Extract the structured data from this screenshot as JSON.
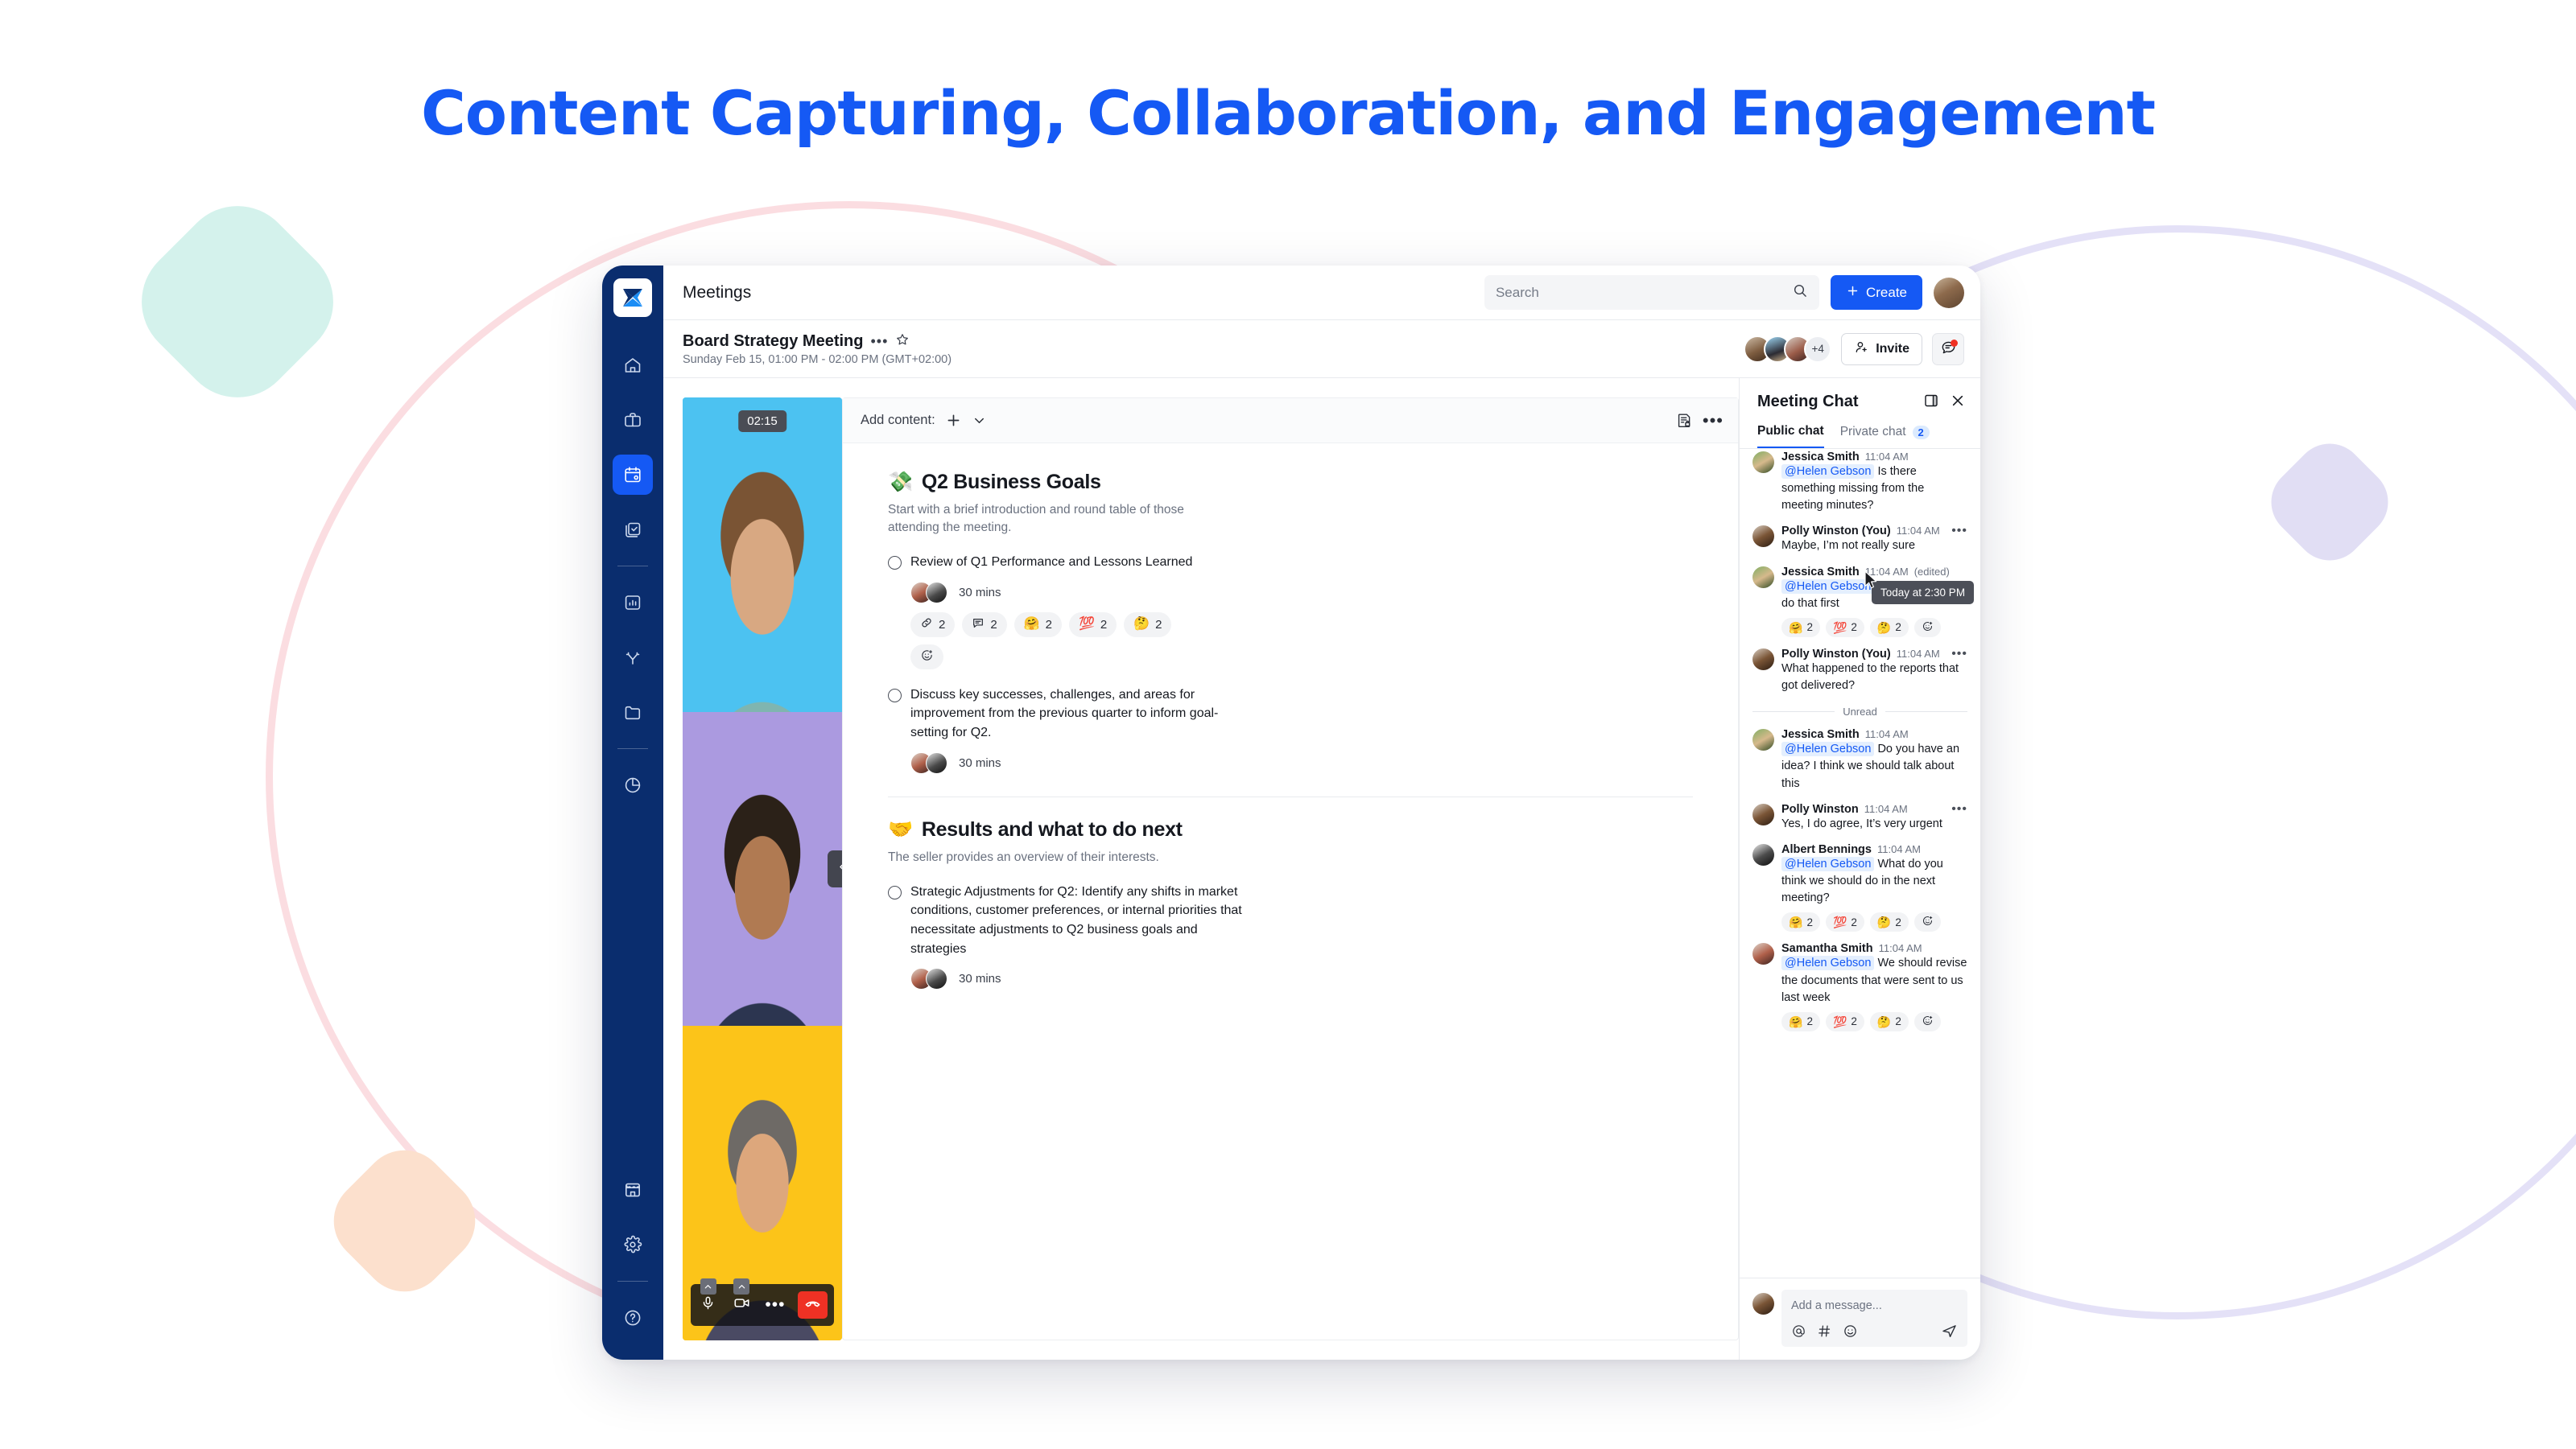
{
  "headline": "Content Capturing, Collaboration, and Engagement",
  "colors": {
    "brand_blue": "#1559f4",
    "rail_navy": "#0a2d6e",
    "danger_red": "#ef3124",
    "mention_blue": "#1559f4",
    "deco_teal": "#d4f2ec",
    "deco_purple": "#e1def4",
    "deco_orange": "#fce0cd"
  },
  "rail": {
    "logo_name": "app-logo",
    "items": [
      {
        "name": "home",
        "icon": "home-icon",
        "active": false
      },
      {
        "name": "briefcase",
        "icon": "briefcase-icon",
        "active": false
      },
      {
        "name": "meetings",
        "icon": "calendar-icon",
        "active": true
      },
      {
        "name": "tasks",
        "icon": "checklist-icon",
        "active": false
      },
      {
        "name": "reports",
        "icon": "bar-chart-icon",
        "active": false
      },
      {
        "name": "workflows",
        "icon": "branch-icon",
        "active": false
      },
      {
        "name": "files",
        "icon": "folder-icon",
        "active": false
      },
      {
        "name": "analytics",
        "icon": "pie-chart-icon",
        "active": false
      }
    ],
    "bottom_items": [
      {
        "name": "marketplace",
        "icon": "store-icon"
      },
      {
        "name": "settings",
        "icon": "gear-icon"
      },
      {
        "name": "help",
        "icon": "question-circle-icon"
      }
    ]
  },
  "topbar": {
    "title": "Meetings",
    "search_placeholder": "Search",
    "search_value": "",
    "create_label": "Create"
  },
  "meeting": {
    "title": "Board Strategy Meeting",
    "datetime": "Sunday Feb 15, 01:00 PM - 02:00 PM (GMT+02:00)",
    "overflow_count": "+4",
    "invite_label": "Invite"
  },
  "video": {
    "timer": "02:15",
    "tiles": [
      {
        "name": "participant-tile-1",
        "bg": "#4cc2f1"
      },
      {
        "name": "participant-tile-2",
        "bg": "#ab9ae0"
      },
      {
        "name": "participant-tile-3",
        "bg": "#fcc419"
      }
    ],
    "controls": [
      {
        "name": "microphone-button",
        "icon": "microphone-icon",
        "has_caret": true
      },
      {
        "name": "camera-button",
        "icon": "video-camera-icon",
        "has_caret": true
      },
      {
        "name": "more-options-button",
        "icon": "ellipsis-icon",
        "has_caret": false
      },
      {
        "name": "hang-up-button",
        "icon": "phone-hangup-icon",
        "has_caret": false
      }
    ]
  },
  "agenda": {
    "toolbar": {
      "add_content_label": "Add content:",
      "plus_icon": "plus-icon",
      "chevron_icon": "chevron-down-icon",
      "notes_icon": "locked-document-icon",
      "more_icon": "ellipsis-icon"
    },
    "sections": [
      {
        "emoji": "💸",
        "title": "Q2 Business Goals",
        "description": "Start with a brief introduction and round table of those attending the meeting.",
        "items": [
          {
            "text": "Review of Q1 Performance and Lessons Learned",
            "duration": "30 mins",
            "pills": [
              {
                "icon": "link-icon",
                "emoji": "",
                "count": "2"
              },
              {
                "icon": "comment-icon",
                "emoji": "",
                "count": "2"
              },
              {
                "icon": "",
                "emoji": "🤗",
                "count": "2"
              },
              {
                "icon": "",
                "emoji": "💯",
                "count": "2"
              },
              {
                "icon": "",
                "emoji": "🤔",
                "count": "2"
              },
              {
                "icon": "add-reaction-icon",
                "emoji": "",
                "count": ""
              }
            ]
          },
          {
            "text": "Discuss key successes, challenges, and areas for improvement from the previous quarter to inform goal-setting for Q2.",
            "duration": "30 mins",
            "pills": []
          }
        ]
      },
      {
        "emoji": "🤝",
        "title": "Results and what to do next",
        "description": "The seller provides an overview of their interests.",
        "items": [
          {
            "text": "Strategic Adjustments for Q2: Identify any shifts in market conditions, customer preferences, or internal priorities that necessitate adjustments to Q2 business goals and strategies",
            "duration": "30 mins",
            "pills": []
          }
        ]
      }
    ]
  },
  "chat": {
    "title": "Meeting Chat",
    "panel_icon": "panel-layout-icon",
    "close_icon": "close-icon",
    "tabs": [
      {
        "label": "Public chat",
        "badge": "",
        "active": true
      },
      {
        "label": "Private chat",
        "badge": "2",
        "active": false
      }
    ],
    "tooltip": "Today at 2:30 PM",
    "unread_label": "Unread",
    "messages": [
      {
        "name": "Jessica Smith",
        "time": "11:04 AM",
        "edited": "",
        "mention": "@Helen Gebson",
        "text": "Is there something missing from the meeting minutes?",
        "has_more": false,
        "pills": []
      },
      {
        "name": "Polly Winston (You)",
        "time": "11:04 AM",
        "edited": "",
        "mention": "",
        "text": "Maybe, I’m not really sure",
        "has_more": true,
        "pills": []
      },
      {
        "name": "Jessica Smith",
        "time": "11:04 AM",
        "edited": "(edited)",
        "mention": "@Helen Gebson",
        "text": "I think we should do that first",
        "has_more": false,
        "pills": [
          {
            "emoji": "🤗",
            "count": "2"
          },
          {
            "emoji": "💯",
            "count": "2"
          },
          {
            "emoji": "🤔",
            "count": "2"
          },
          {
            "emoji": "",
            "count": ""
          }
        ]
      },
      {
        "name": "Polly Winston (You)",
        "time": "11:04 AM",
        "edited": "",
        "mention": "",
        "text": "What happened to the reports that got delivered?",
        "has_more": true,
        "pills": []
      },
      {
        "name": "Jessica Smith",
        "time": "11:04 AM",
        "edited": "",
        "mention": "@Helen Gebson",
        "text": "Do you have an idea? I think we should talk about this",
        "has_more": false,
        "pills": []
      },
      {
        "name": "Polly Winston",
        "time": "11:04 AM",
        "edited": "",
        "mention": "",
        "text": "Yes, I do agree, It’s very urgent",
        "has_more": true,
        "pills": []
      },
      {
        "name": "Albert Bennings",
        "time": "11:04 AM",
        "edited": "",
        "mention": "@Helen Gebson",
        "text": "What do you think we should do in the next meeting?",
        "has_more": false,
        "pills": [
          {
            "emoji": "🤗",
            "count": "2"
          },
          {
            "emoji": "💯",
            "count": "2"
          },
          {
            "emoji": "🤔",
            "count": "2"
          },
          {
            "emoji": "",
            "count": ""
          }
        ]
      },
      {
        "name": "Samantha Smith",
        "time": "11:04 AM",
        "edited": "",
        "mention": "@Helen Gebson",
        "text": "We should revise the documents that were sent to us last week",
        "has_more": false,
        "pills": [
          {
            "emoji": "🤗",
            "count": "2"
          },
          {
            "emoji": "💯",
            "count": "2"
          },
          {
            "emoji": "🤔",
            "count": "2"
          },
          {
            "emoji": "",
            "count": ""
          }
        ]
      }
    ],
    "composer": {
      "placeholder": "Add a message...",
      "value": "",
      "tools": [
        {
          "name": "mention-icon",
          "glyph": "@"
        },
        {
          "name": "channel-icon",
          "glyph": "#"
        },
        {
          "name": "emoji-icon",
          "glyph": "☺"
        }
      ],
      "send_icon": "send-icon"
    }
  }
}
